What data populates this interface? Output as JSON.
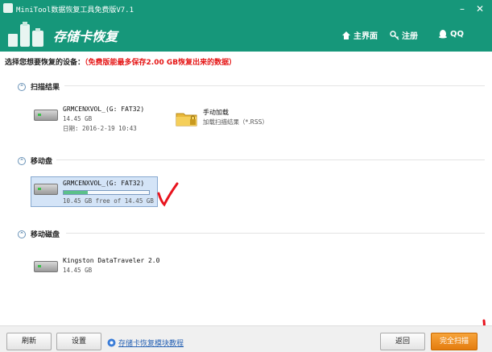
{
  "window": {
    "title": "MiniTool数据恢复工具免费版V7.1"
  },
  "header": {
    "app_title": "存储卡恢复",
    "nav": [
      {
        "label": "主界面",
        "icon": "home-icon"
      },
      {
        "label": "注册",
        "icon": "key-icon"
      },
      {
        "label": "QQ",
        "icon": "qq-icon"
      }
    ]
  },
  "prompt": {
    "label": "选择您想要恢复的设备：",
    "notice": "（免费版能最多保存2.00 GB恢复出来的数据）"
  },
  "sections": {
    "scan_results": {
      "title": "扫描结果",
      "drive": {
        "name": "GRMCENXVOL_(G: FAT32)",
        "size": "14.45 GB",
        "date": "日期: 2016-2-19 10:43"
      },
      "manual": {
        "name": "手动加载",
        "sub": "加载扫描结果（*.RSS）"
      }
    },
    "removable": {
      "title": "移动盘",
      "drive": {
        "name": "GRMCENXVOL_(G: FAT32)",
        "free": "10.45 GB free of 14.45 GB",
        "used_fraction": 0.28
      }
    },
    "removable_disk": {
      "title": "移动磁盘",
      "drive": {
        "name": "Kingston DataTraveler 2.0",
        "size": "14.45 GB"
      }
    }
  },
  "footer": {
    "refresh": "刷新",
    "settings": "设置",
    "tutorial_link": "存储卡恢复模块教程",
    "back": "返回",
    "full_scan": "完全扫描"
  },
  "colors": {
    "header_bg": "#16977a",
    "accent": "#e47c0f",
    "highlight": "#e51515",
    "annotation": "#e8141e"
  }
}
